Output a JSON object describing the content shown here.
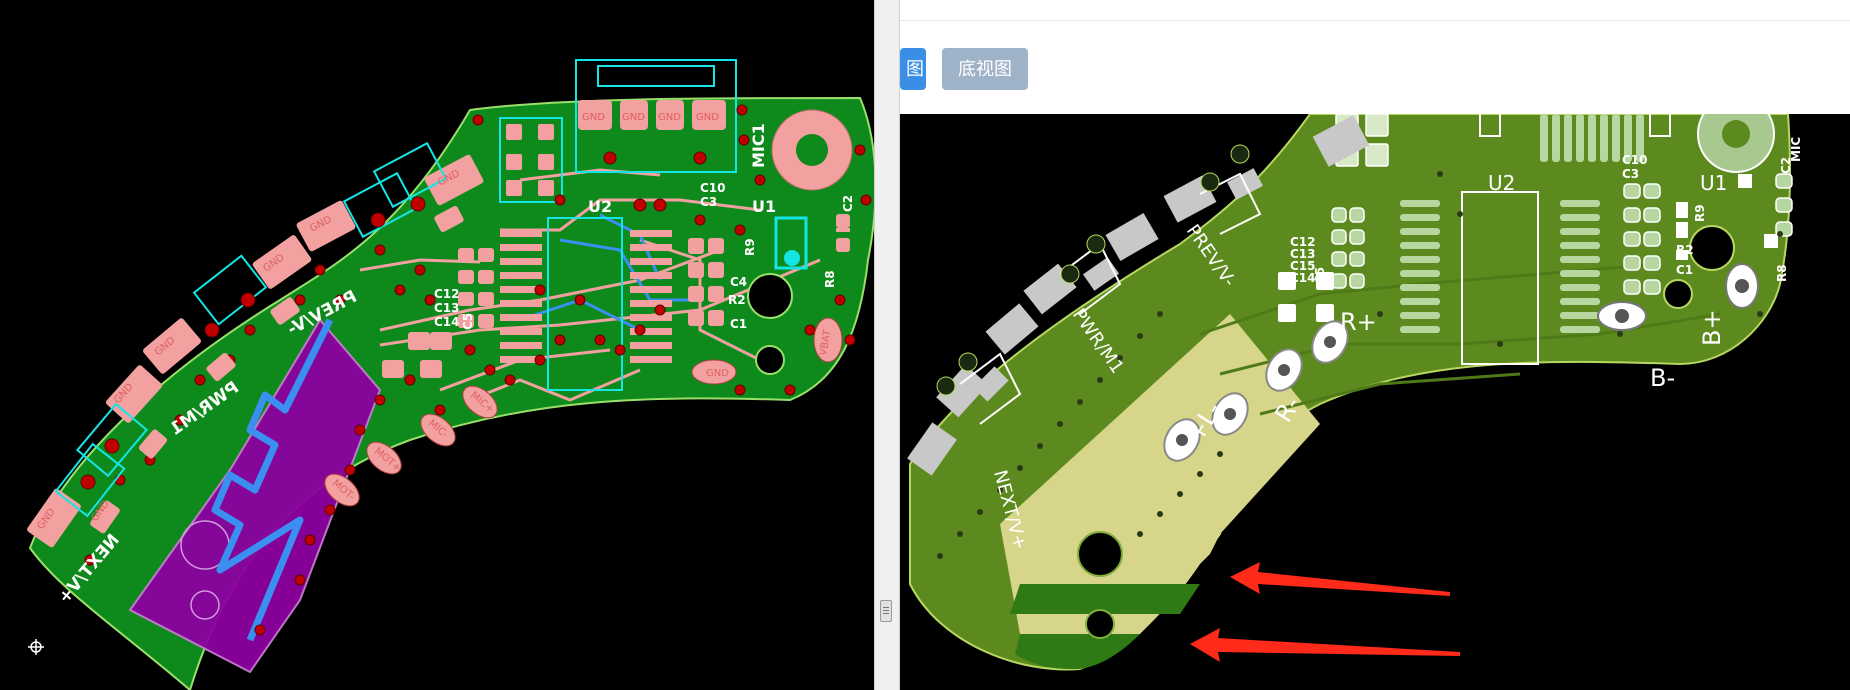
{
  "left_view": {
    "refdes": [
      "U2",
      "U1",
      "MIC1",
      "C10",
      "C3",
      "R9",
      "C2",
      "C4",
      "R8",
      "R2",
      "C1",
      "C12",
      "C13",
      "C14",
      "C5"
    ],
    "silk_rotated": [
      "PREV/V-",
      "PWR/M1",
      "NEXT/V+"
    ],
    "pads": {
      "gnd": [
        "GND",
        "GND",
        "GND",
        "GND",
        "GND",
        "GND",
        "GND",
        "GND",
        "GND",
        "GND",
        "GND",
        "GND"
      ],
      "vbat": "VBAT",
      "micp": "MIC+",
      "micn": "MIC-",
      "mot1": "MOT+",
      "mot2": "MOT-"
    }
  },
  "divider": {
    "grip": "|||"
  },
  "toolbar": {
    "top_view_label": "图",
    "bottom_view_label": "底视图"
  },
  "bottom_view": {
    "refdes": [
      "C10",
      "C3",
      "U1",
      "C2",
      "U2",
      "R9",
      "C12",
      "C13",
      "C15",
      "C14",
      "C5",
      "R2",
      "C1",
      "R8"
    ],
    "silk_rotated": [
      "PREV/V-",
      "PWR/M1",
      "NEXT/V+"
    ],
    "silk_plain": [
      "R+",
      "R-",
      "B+",
      "B-",
      "+L-"
    ],
    "mic": "MIC"
  },
  "annotation": {
    "arrow_color": "#ff2a1a",
    "arrow_count": 2
  },
  "colors": {
    "board_left": "#0e8a1c",
    "copper_pad": "#f2a0a0",
    "silk_cyan": "#14e5e5",
    "keepout": "#8c00a0",
    "trace_blue": "#3a8ff0",
    "board_right": "#5d8a1e",
    "silk_white": "#ffffff",
    "pad_gray": "#c8c8c8",
    "copper_fill": "#d6d58a"
  }
}
